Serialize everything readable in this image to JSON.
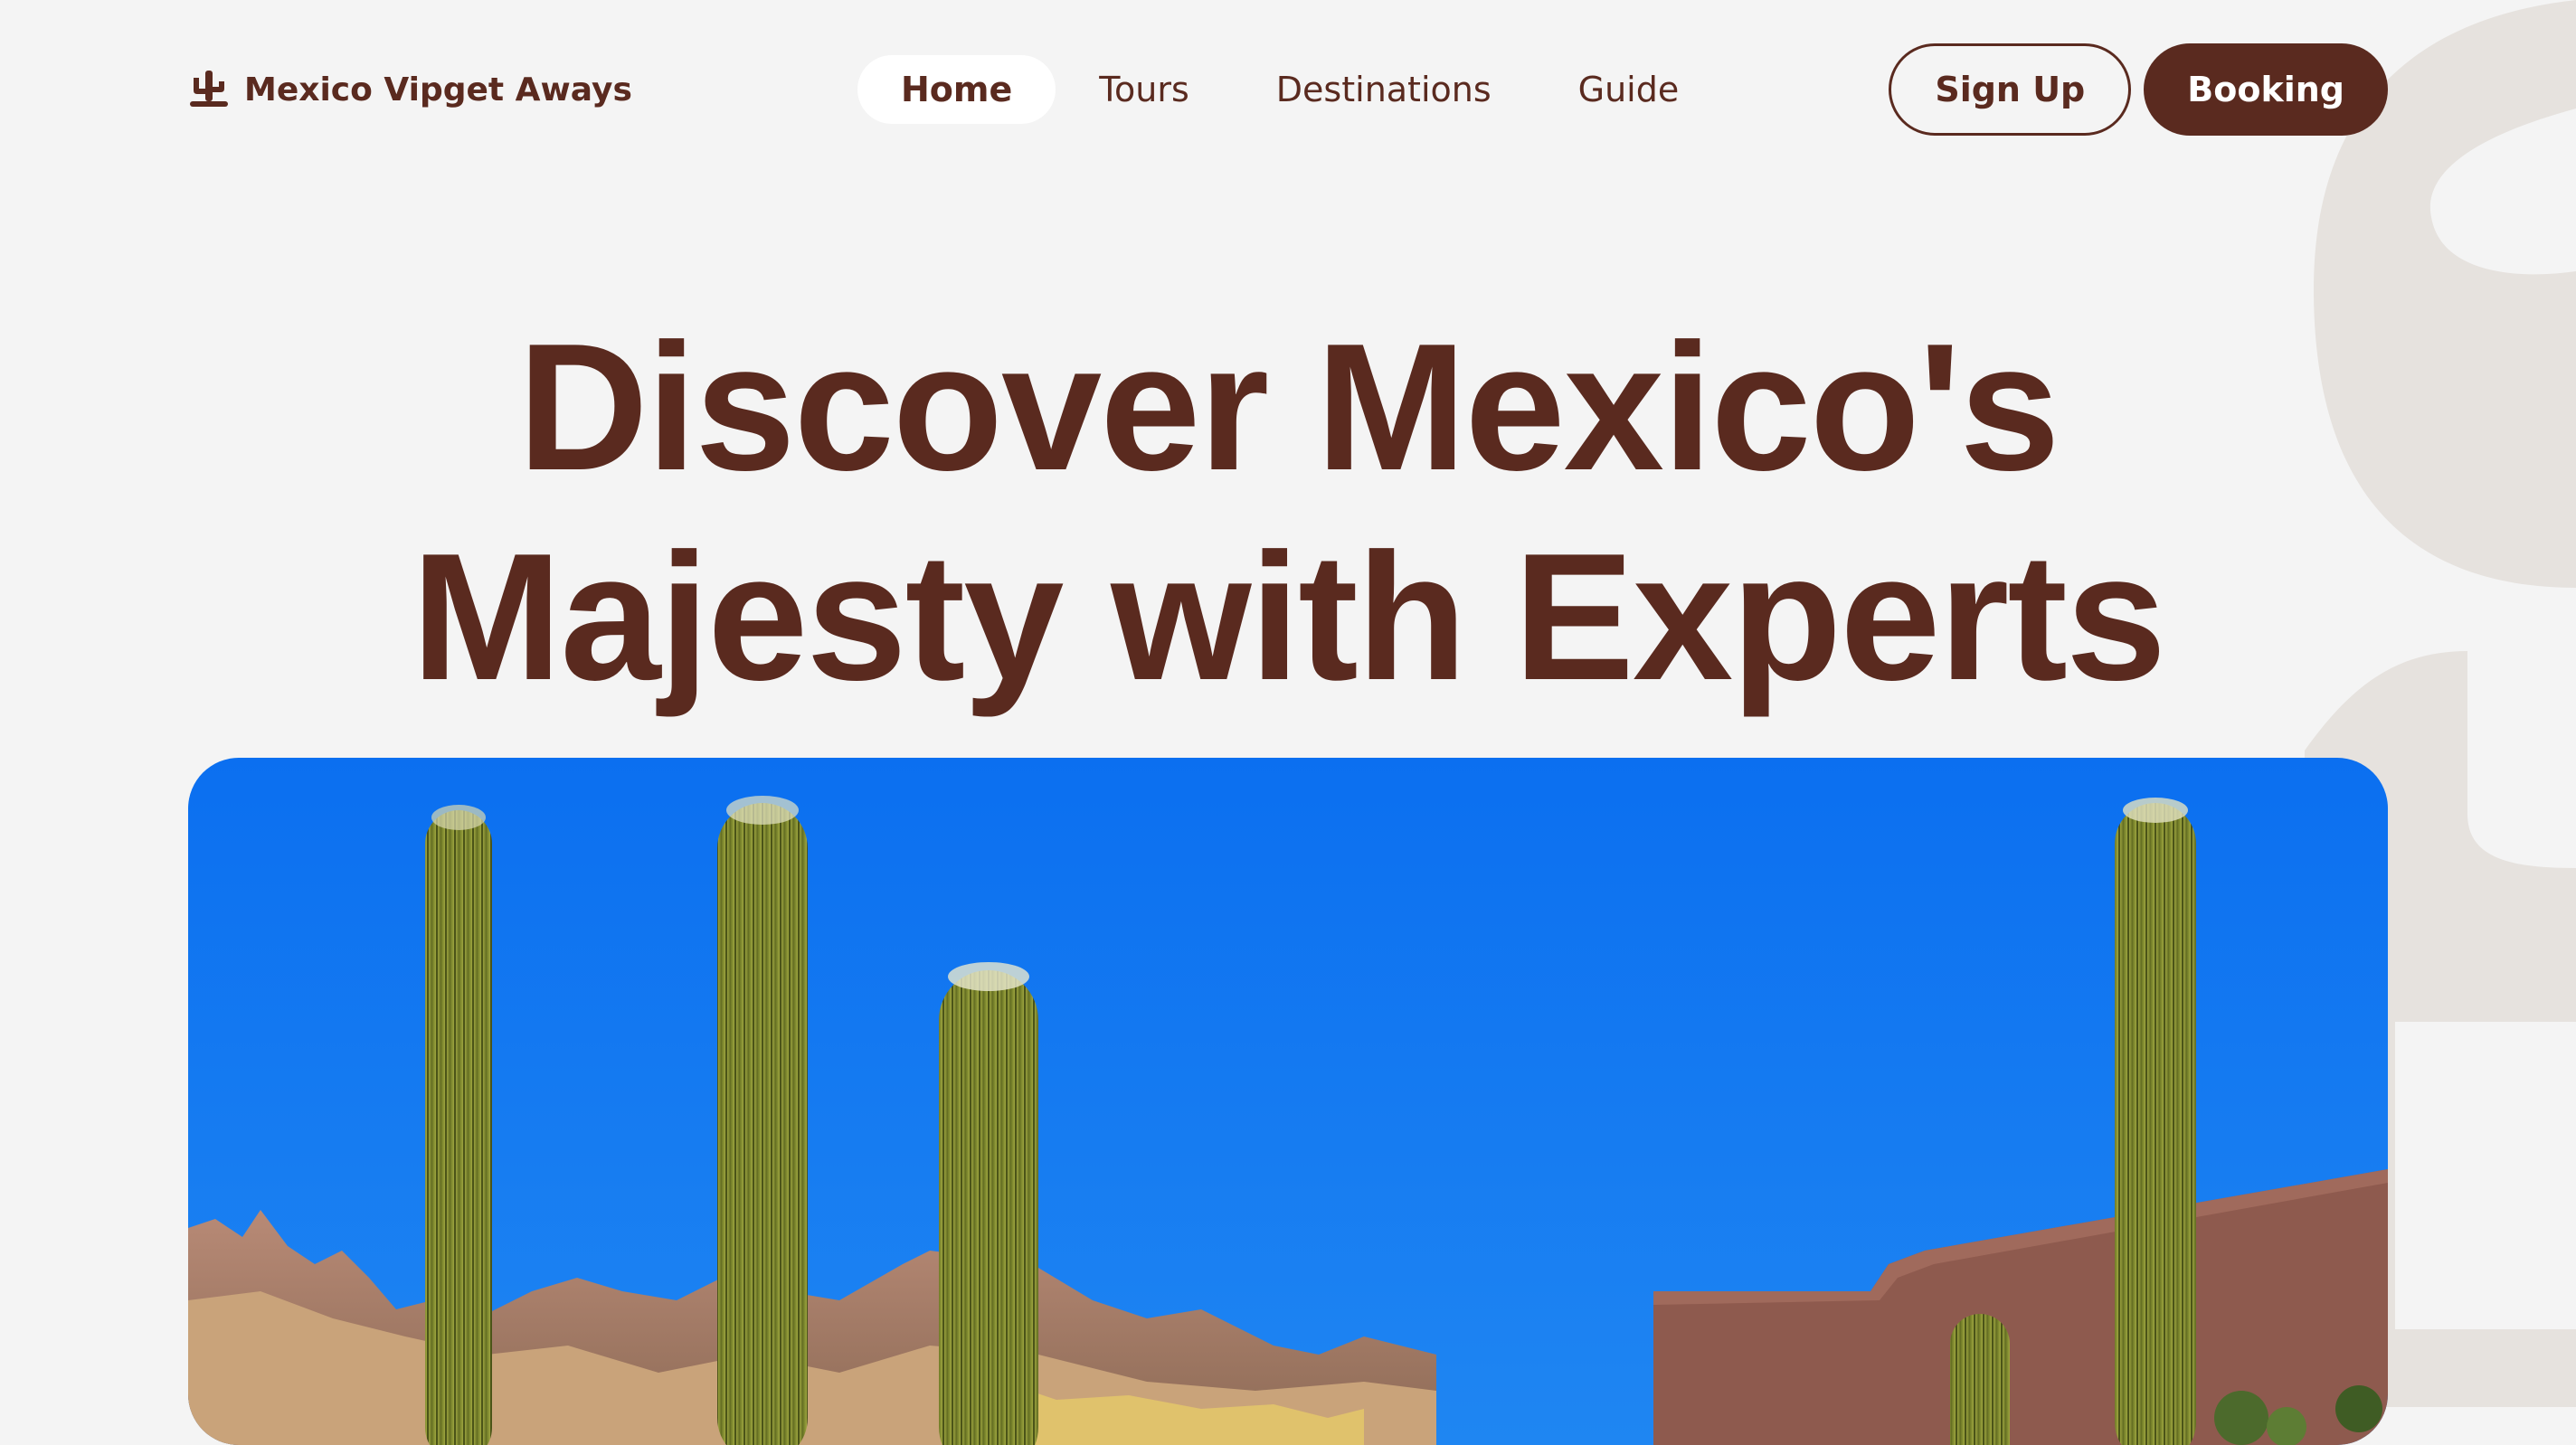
{
  "brand": {
    "name": "Mexico Vipget Aways",
    "icon": "cactus-logo-icon"
  },
  "nav": {
    "items": [
      {
        "label": "Home",
        "active": true
      },
      {
        "label": "Tours",
        "active": false
      },
      {
        "label": "Destinations",
        "active": false
      },
      {
        "label": "Guide",
        "active": false
      }
    ]
  },
  "actions": {
    "signup_label": "Sign Up",
    "booking_label": "Booking"
  },
  "hero": {
    "title_line1": "Discover Mexico's",
    "title_line2": "Majesty with Experts",
    "image": "desert-saguaro-cactus-scene"
  },
  "colors": {
    "background": "#f4f4f4",
    "brand_brown": "#5a2a1f",
    "sky_blue": "#1078f0",
    "active_pill": "#ffffff"
  }
}
